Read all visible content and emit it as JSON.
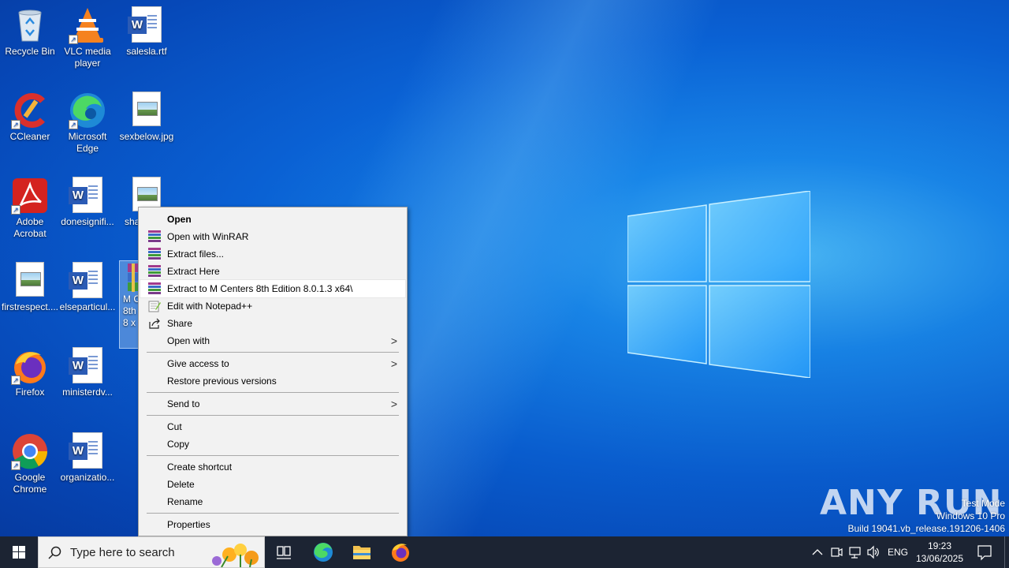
{
  "desktop": {
    "icons": [
      {
        "label": "Recycle Bin"
      },
      {
        "label": "VLC media player"
      },
      {
        "label": "salesla.rtf"
      },
      {
        "label": "CCleaner"
      },
      {
        "label": "Microsoft Edge"
      },
      {
        "label": "sexbelow.jpg"
      },
      {
        "label": "Adobe Acrobat"
      },
      {
        "label": "donesignifi..."
      },
      {
        "label": "sha"
      },
      {
        "label": "firstrespect...."
      },
      {
        "label": "elseparticul..."
      },
      {
        "label": "M C 8th 8 x"
      },
      {
        "label": "Firefox"
      },
      {
        "label": "ministerdv..."
      },
      {
        "label": "Google Chrome"
      },
      {
        "label": "organizatio..."
      }
    ]
  },
  "context_menu": {
    "items": [
      {
        "label": "Open",
        "icon": "none"
      },
      {
        "label": "Open with WinRAR",
        "icon": "winrar-icon"
      },
      {
        "label": "Extract files...",
        "icon": "winrar-icon"
      },
      {
        "label": "Extract Here",
        "icon": "winrar-icon"
      },
      {
        "label": "Extract to M Centers 8th Edition 8.0.1.3 x64\\",
        "icon": "winrar-icon"
      },
      {
        "label": "Edit with Notepad++",
        "icon": "notepadpp-icon"
      },
      {
        "label": "Share",
        "icon": "share-icon"
      },
      {
        "label": "Open with",
        "icon": "none"
      },
      {
        "label": "Give access to",
        "icon": "none"
      },
      {
        "label": "Restore previous versions",
        "icon": "none"
      },
      {
        "label": "Send to",
        "icon": "none"
      },
      {
        "label": "Cut",
        "icon": "none"
      },
      {
        "label": "Copy",
        "icon": "none"
      },
      {
        "label": "Create shortcut",
        "icon": "none"
      },
      {
        "label": "Delete",
        "icon": "none"
      },
      {
        "label": "Rename",
        "icon": "none"
      },
      {
        "label": "Properties",
        "icon": "none"
      }
    ]
  },
  "watermark": {
    "brand": "ANY RUN",
    "mode": "Test Mode",
    "edition": "Windows 10 Pro",
    "build": "Build 19041.vb_release.191206-1406"
  },
  "taskbar": {
    "search_placeholder": "Type here to search",
    "language": "ENG",
    "time": "19:23",
    "date": "13/06/2025"
  },
  "colors": {
    "desktop_blue": "#0a64d8",
    "taskbar": "#1c2433",
    "menu_bg": "#f2f2f2"
  }
}
